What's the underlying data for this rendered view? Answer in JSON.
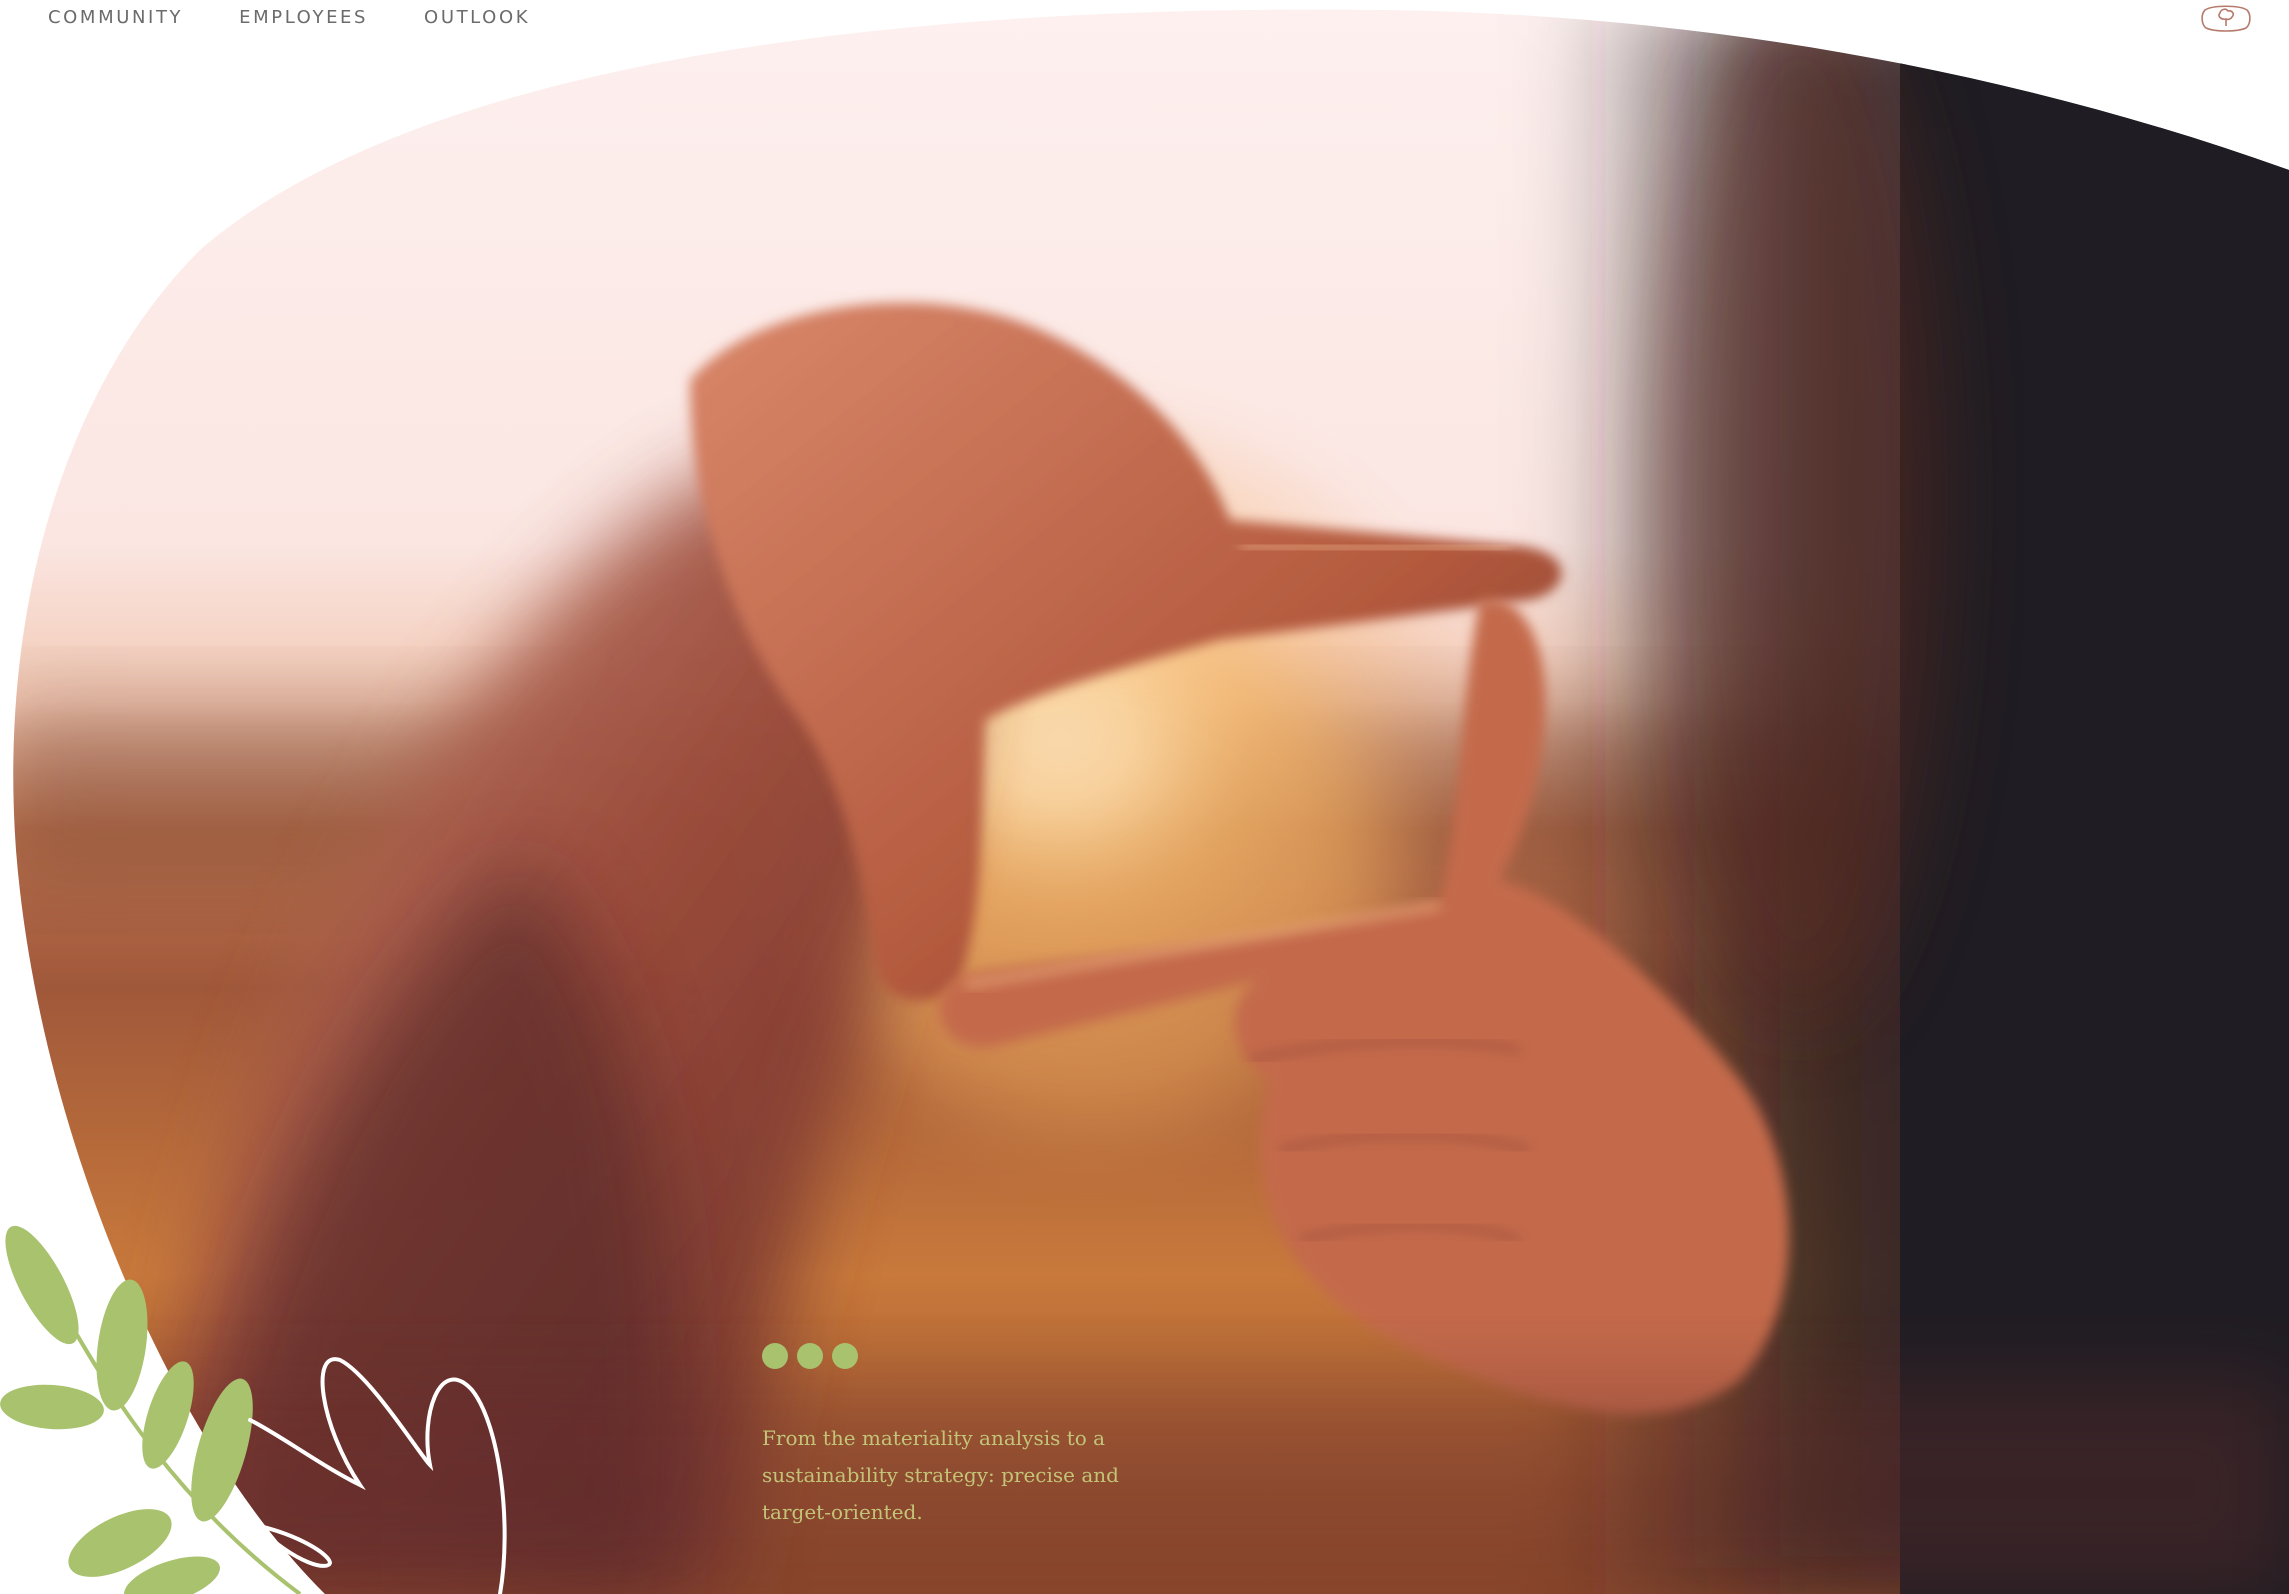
{
  "nav": {
    "items": [
      {
        "label": "COMMUNITY"
      },
      {
        "label": "EMPLOYEES"
      },
      {
        "label": "OUTLOOK"
      }
    ]
  },
  "brand": {
    "logo_icon": "tree-in-frame-icon",
    "logo_color": "#b57a6c"
  },
  "hero": {
    "image_icon": "hands-framing-sunset-photo"
  },
  "slider": {
    "dot_count": 3,
    "dot_color": "#a8c26e"
  },
  "caption": {
    "text": "From the materiality analysis to a sustainability strategy: precise and target-oriented.",
    "color": "#c3c477"
  },
  "decor": {
    "leaf_color": "#a8c26e",
    "outline_color": "#ffffff"
  }
}
